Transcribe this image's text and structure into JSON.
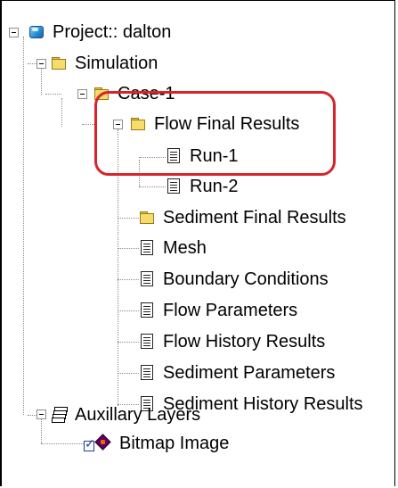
{
  "tree": {
    "project": {
      "label": "Project:: dalton",
      "icon": "project-cube-icon"
    },
    "simulation": {
      "label": "Simulation",
      "icon": "folder-icon"
    },
    "case": {
      "label": "Case-1",
      "icon": "folder-icon"
    },
    "flow_final_results": {
      "label": "Flow Final Results",
      "icon": "folder-icon",
      "children": [
        {
          "label": "Run-1",
          "icon": "document-icon"
        },
        {
          "label": "Run-2",
          "icon": "document-icon"
        }
      ]
    },
    "case_items": [
      {
        "label": "Sediment Final Results",
        "icon": "folder-icon"
      },
      {
        "label": "Mesh",
        "icon": "document-icon"
      },
      {
        "label": "Boundary Conditions",
        "icon": "document-icon"
      },
      {
        "label": "Flow Parameters",
        "icon": "document-icon"
      },
      {
        "label": "Flow History Results",
        "icon": "document-icon"
      },
      {
        "label": "Sediment Parameters",
        "icon": "document-icon"
      },
      {
        "label": "Sediment History Results",
        "icon": "document-icon"
      }
    ],
    "auxiliary": {
      "label": "Auxillary Layers",
      "icon": "layers-icon"
    },
    "bitmap": {
      "label": "Bitmap Image",
      "icon": "diamond-icon",
      "checked": true
    }
  },
  "colors": {
    "highlight": "#d9232a",
    "folder": "#f5dc6b",
    "tree_line": "#8a8a8a"
  }
}
